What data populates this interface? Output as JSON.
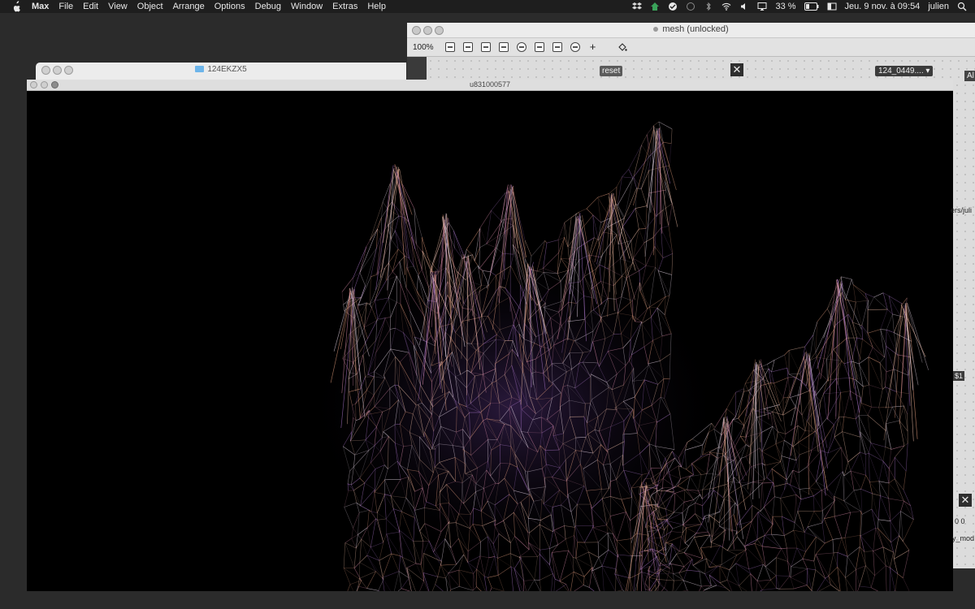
{
  "menubar": {
    "app": "Max",
    "menus": [
      "File",
      "Edit",
      "View",
      "Object",
      "Arrange",
      "Options",
      "Debug",
      "Window",
      "Extras",
      "Help"
    ],
    "battery": "33 %",
    "datetime": "Jeu. 9 nov. à  09:54",
    "user": "julien"
  },
  "mesh_window": {
    "title": "mesh (unlocked)",
    "zoom": "100%",
    "reset_label": "reset",
    "umenu_label": "124_0449....",
    "right_label": "Al"
  },
  "finder_window": {
    "title": "124EKZX5"
  },
  "render_window": {
    "title": "u831000577"
  },
  "right_strip": {
    "path_fragment": "ers/juli",
    "dollar_box": "$1",
    "num_box": "0 0",
    "mod_fragment": "y_mod"
  },
  "colors": {
    "menubar_bg": "#1e1e1e",
    "render_bg": "#000000",
    "mesh_warm": "#e8a080",
    "mesh_purple": "#b07ad0",
    "mesh_white": "#f0e0f0"
  }
}
